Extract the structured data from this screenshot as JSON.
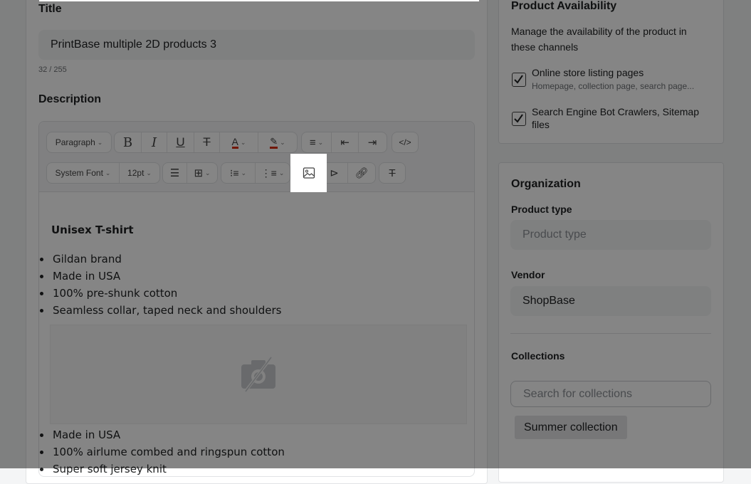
{
  "left": {
    "title_label": "Title",
    "title_value": "PrintBase multiple 2D products 3",
    "title_count": "32 / 255",
    "description_label": "Description",
    "toolbar": {
      "paragraph": "Paragraph",
      "font_family": "System Font",
      "font_size": "12pt"
    },
    "editor": {
      "heading": "Unisex T-shirt",
      "list1": [
        "Gildan brand",
        "Made in USA",
        "100% pre-shunk cotton",
        "Seamless collar, taped neck and shoulders"
      ],
      "list2": [
        "Made in USA",
        "100% airlume combed and ringspun cotton",
        "Super soft jersey knit"
      ]
    }
  },
  "right": {
    "availability": {
      "title": "Product Availability",
      "desc": "Manage the availability of the product in these channels",
      "option1_title": "Online store listing pages",
      "option1_sub": "Homepage, collection page, search page...",
      "option2_title": "Search Engine Bot Crawlers, Sitemap files"
    },
    "organization": {
      "title": "Organization",
      "product_type_label": "Product type",
      "product_type_placeholder": "Product type",
      "vendor_label": "Vendor",
      "vendor_value": "ShopBase",
      "collections_label": "Collections",
      "collections_placeholder": "Search for collections",
      "collection_tag": "Summer collection"
    }
  },
  "highlight": "insert-image-icon"
}
